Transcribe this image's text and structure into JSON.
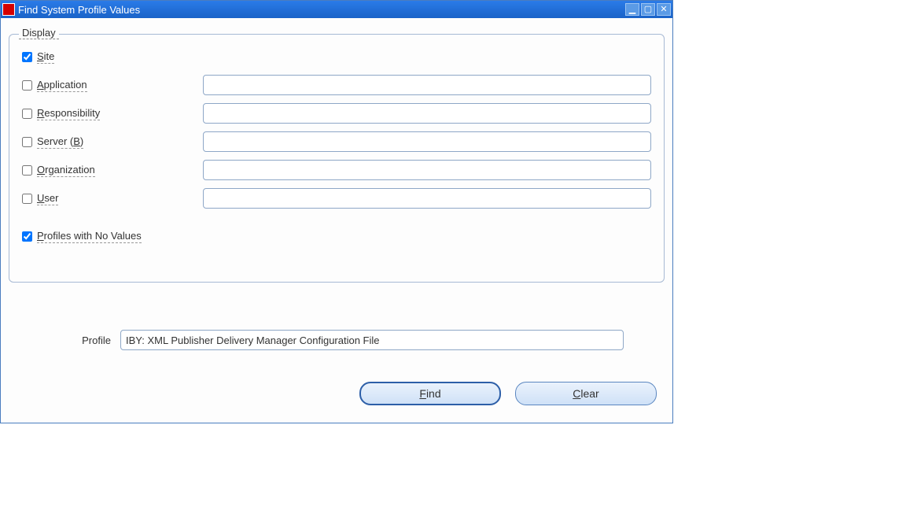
{
  "window": {
    "title": "Find System Profile Values"
  },
  "display": {
    "legend": "Display",
    "site": {
      "label": "Site",
      "checked": true
    },
    "application": {
      "label": "Application",
      "checked": false,
      "value": ""
    },
    "responsibility": {
      "label": "Responsibility",
      "checked": false,
      "value": ""
    },
    "server": {
      "label": "Server (B)",
      "checked": false,
      "value": ""
    },
    "organization": {
      "label": "Organization",
      "checked": false,
      "value": ""
    },
    "user": {
      "label": "User",
      "checked": false,
      "value": ""
    },
    "profiles_no_values": {
      "label": "Profiles with No Values",
      "checked": true
    }
  },
  "profile": {
    "label": "Profile",
    "value": "IBY: XML Publisher Delivery Manager Configuration File"
  },
  "buttons": {
    "find": "Find",
    "clear": "Clear"
  }
}
